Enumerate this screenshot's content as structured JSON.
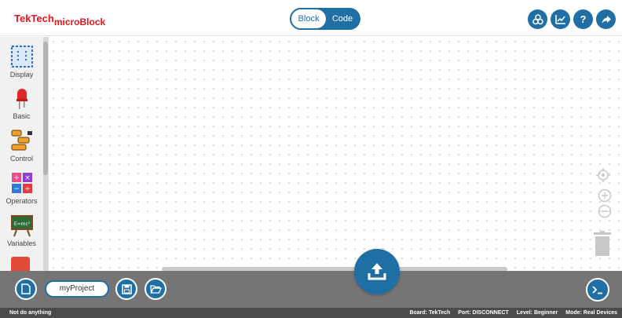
{
  "header": {
    "logo_main": "TekTech",
    "logo_sub": "microBlock",
    "toggle": {
      "block_label": "Block",
      "code_label": "Code",
      "active": "Block"
    },
    "icons": [
      "extensions-icon",
      "chart-icon",
      "help-icon",
      "share-icon"
    ]
  },
  "sidebar": {
    "categories": [
      {
        "label": "Display",
        "icon": "display-icon"
      },
      {
        "label": "Basic",
        "icon": "led-icon"
      },
      {
        "label": "Control",
        "icon": "control-icon"
      },
      {
        "label": "Operators",
        "icon": "operators-icon"
      },
      {
        "label": "Variables",
        "icon": "variables-icon"
      }
    ]
  },
  "workspace": {
    "controls": [
      "recenter-icon",
      "zoom-in-icon",
      "zoom-out-icon",
      "trash-icon"
    ]
  },
  "toolbar": {
    "project_name": "myProject",
    "buttons": [
      "new-file-icon",
      "save-icon",
      "open-folder-icon",
      "upload-icon",
      "terminal-icon"
    ]
  },
  "status": {
    "message": "Not do anything",
    "board": "Board: TekTech",
    "port": "Port: DISCONNECT",
    "level": "Level: Beginner",
    "mode": "Mode: Real Devices"
  },
  "colors": {
    "accent": "#1f6fa5",
    "logo": "#e8141c",
    "toolbar": "#757575",
    "statusbar": "#4a4a4a"
  }
}
